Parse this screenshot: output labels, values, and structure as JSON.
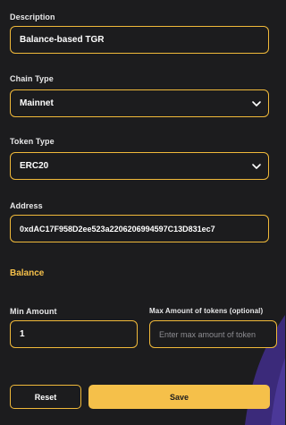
{
  "form": {
    "description": {
      "label": "Description",
      "value": "Balance-based TGR"
    },
    "chain_type": {
      "label": "Chain Type",
      "value": "Mainnet"
    },
    "token_type": {
      "label": "Token Type",
      "value": "ERC20"
    },
    "address": {
      "label": "Address",
      "value": "0xdAC17F958D2ee523a2206206994597C13D831ec7"
    },
    "balance_title": "Balance",
    "min_amount": {
      "label": "Min Amount",
      "value": "1"
    },
    "max_amount": {
      "label": "Max Amount of tokens (optional)",
      "placeholder": "Enter max amount of token"
    }
  },
  "actions": {
    "reset_label": "Reset",
    "save_label": "Save"
  },
  "colors": {
    "accent": "#f5c04a",
    "border": "#f0b93a",
    "background": "#1c1c1e",
    "decor": "#3b2a7a"
  },
  "icons": {
    "select_indicator": "chevron-down-icon",
    "background_decor": "wave-decoration"
  }
}
